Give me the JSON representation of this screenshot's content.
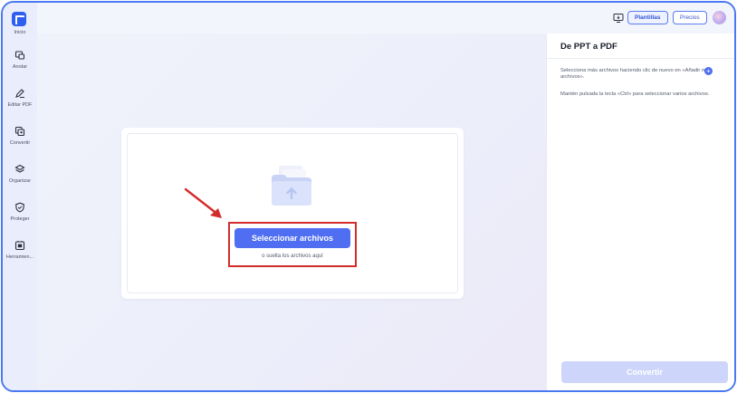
{
  "sidebar": {
    "logo_label": "Inicio",
    "items": [
      {
        "label": "Anotar",
        "icon": "annotate-icon"
      },
      {
        "label": "Editar PDF",
        "icon": "edit-icon"
      },
      {
        "label": "Convertir",
        "icon": "convert-icon"
      },
      {
        "label": "Organizar",
        "icon": "organize-icon"
      },
      {
        "label": "Proteger",
        "icon": "shield-icon"
      },
      {
        "label": "Herramien...",
        "icon": "tools-icon"
      }
    ]
  },
  "topbar": {
    "plantillas_label": "Plantillas",
    "precios_label": "Precios"
  },
  "dropzone": {
    "select_button": "Seleccionar archivos",
    "drop_hint": "o suelta los archivos aquí"
  },
  "panel": {
    "title": "De PPT a PDF",
    "text1": "Selecciona más archivos haciendo clic de nuevo en «Añadir más archivos».",
    "text2": "Mantén pulsada la tecla «Ctrl» para seleccionar varios archivos.",
    "convert_button": "Convertir"
  },
  "colors": {
    "accent": "#4f6ef2",
    "frame_border": "#4a78f0",
    "highlight": "#d42c2c",
    "disabled_button": "#cdd6fa"
  }
}
